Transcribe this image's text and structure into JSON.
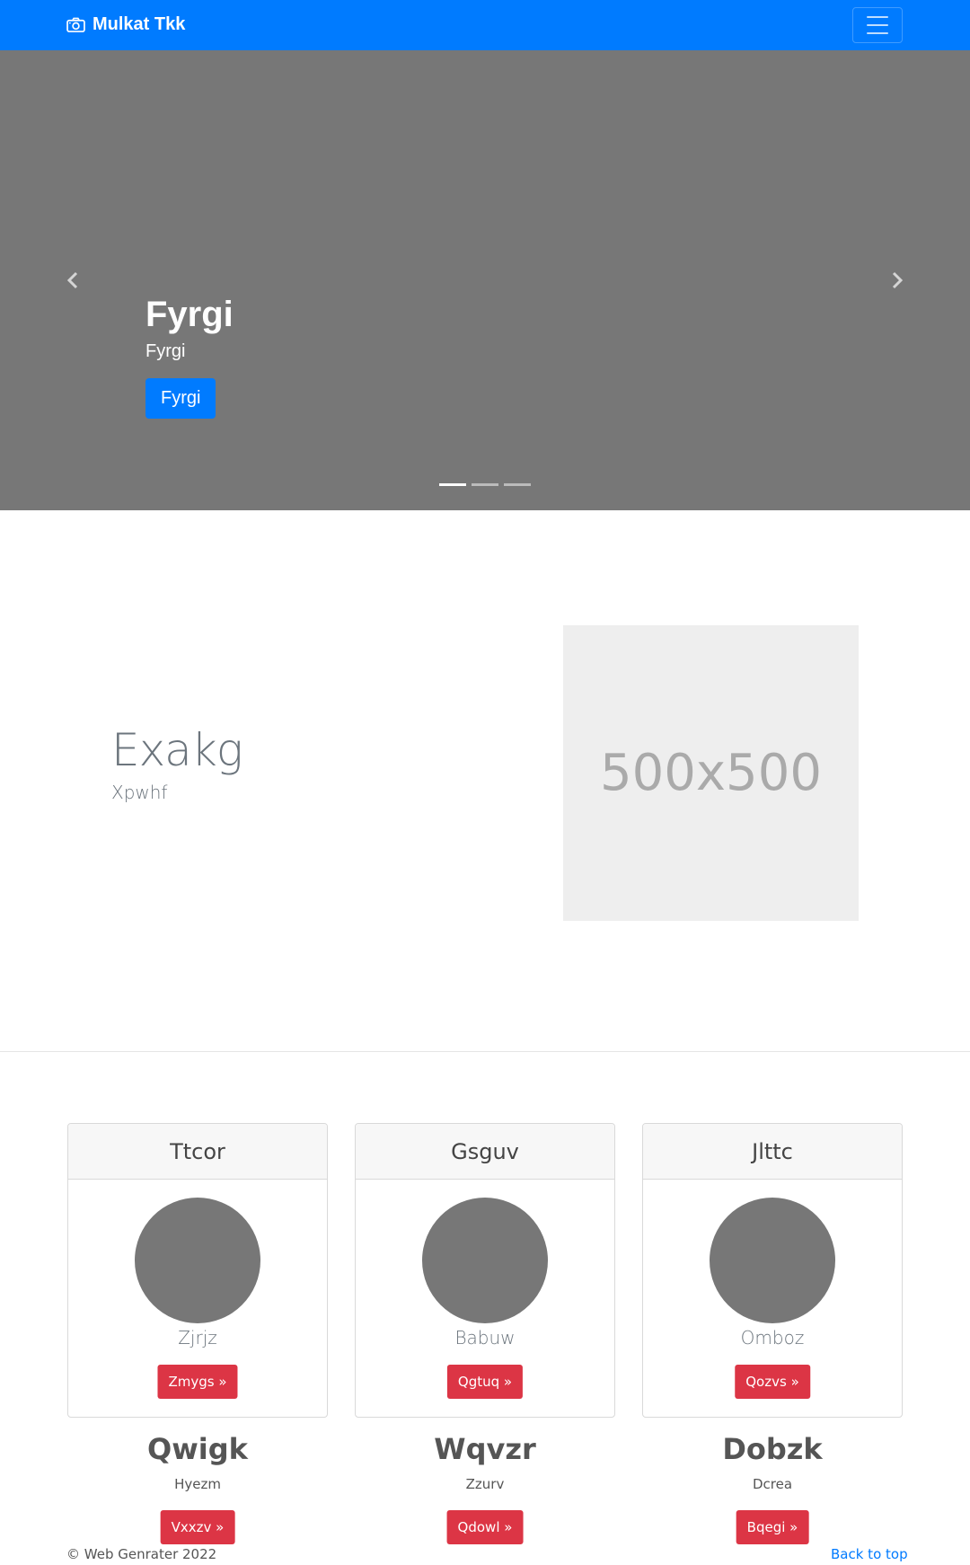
{
  "navbar": {
    "brand": "Mulkat Tkk",
    "brand_icon": "camera-icon",
    "toggler_icon": "hamburger-menu-icon",
    "color": "#007bff"
  },
  "carousel": {
    "background": "#777777",
    "heading": "Fyrgi",
    "text": "Fyrgi",
    "button_label": "Fyrgi",
    "prev_icon": "chevron-left-icon",
    "next_icon": "chevron-right-icon",
    "slide_count": 3,
    "active_slide": 1
  },
  "feature": {
    "heading": "Exakg",
    "lead": "Xpwhf",
    "image_label": "500x500"
  },
  "cards": [
    {
      "header": "Ttcor",
      "text": "Zjrjz",
      "button": "Zmygs »"
    },
    {
      "header": "Gsguv",
      "text": "Babuw",
      "button": "Qgtuq »"
    },
    {
      "header": "Jlttc",
      "text": "Omboz",
      "button": "Qozvs »"
    }
  ],
  "columns": [
    {
      "heading": "Qwigk",
      "text": "Hyezm",
      "button": "Vxxzv »"
    },
    {
      "heading": "Wqvzr",
      "text": "Zzurv",
      "button": "Qdowl »"
    },
    {
      "heading": "Dobzk",
      "text": "Dcrea",
      "button": "Bqegi »"
    }
  ],
  "footer": {
    "copyright": "© Web Genrater 2022",
    "back_to_top": "Back to top"
  },
  "colors": {
    "primary": "#007bff",
    "danger": "#dc3545",
    "muted": "#6c757d"
  }
}
